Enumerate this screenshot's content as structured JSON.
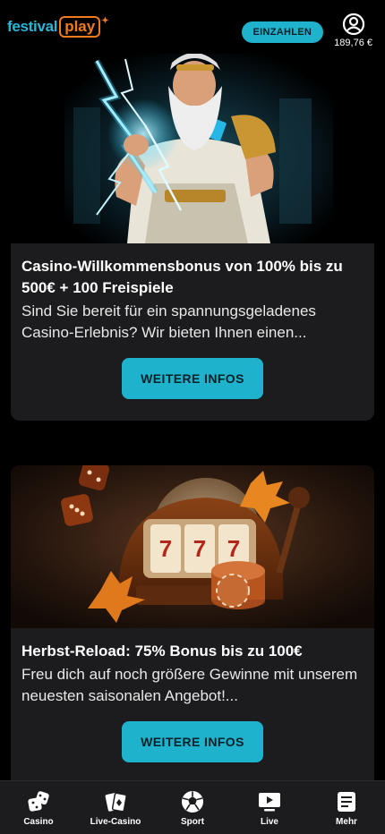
{
  "header": {
    "logo_part1": "festival",
    "logo_part2": "play",
    "deposit_label": "EINZAHLEN",
    "balance": "189,76 €"
  },
  "promos": [
    {
      "title": "Casino-Willkommensbonus von 100% bis zu 500€ + 100 Freispiele",
      "text": "Sind Sie bereit für ein spannungsgeladenes Casino-Erlebnis? Wir bieten Ihnen einen...",
      "button": "WEITERE INFOS"
    },
    {
      "title": "Herbst-Reload: 75% Bonus bis zu 100€",
      "text": "Freu dich auf noch größere Gewinne mit unserem neuesten saisonalen Angebot!...",
      "button": "WEITERE INFOS"
    }
  ],
  "slot_reels": [
    "7",
    "7",
    "7"
  ],
  "nav": [
    {
      "label": "Casino",
      "icon": "dice-icon"
    },
    {
      "label": "Live-Casino",
      "icon": "cards-icon"
    },
    {
      "label": "Sport",
      "icon": "soccer-ball-icon"
    },
    {
      "label": "Live",
      "icon": "tv-play-icon"
    },
    {
      "label": "Mehr",
      "icon": "menu-list-icon"
    }
  ],
  "colors": {
    "accent": "#1fb2cc",
    "logo_orange": "#f07a1e",
    "card_bg": "#1c1c1e",
    "background": "#000000"
  }
}
